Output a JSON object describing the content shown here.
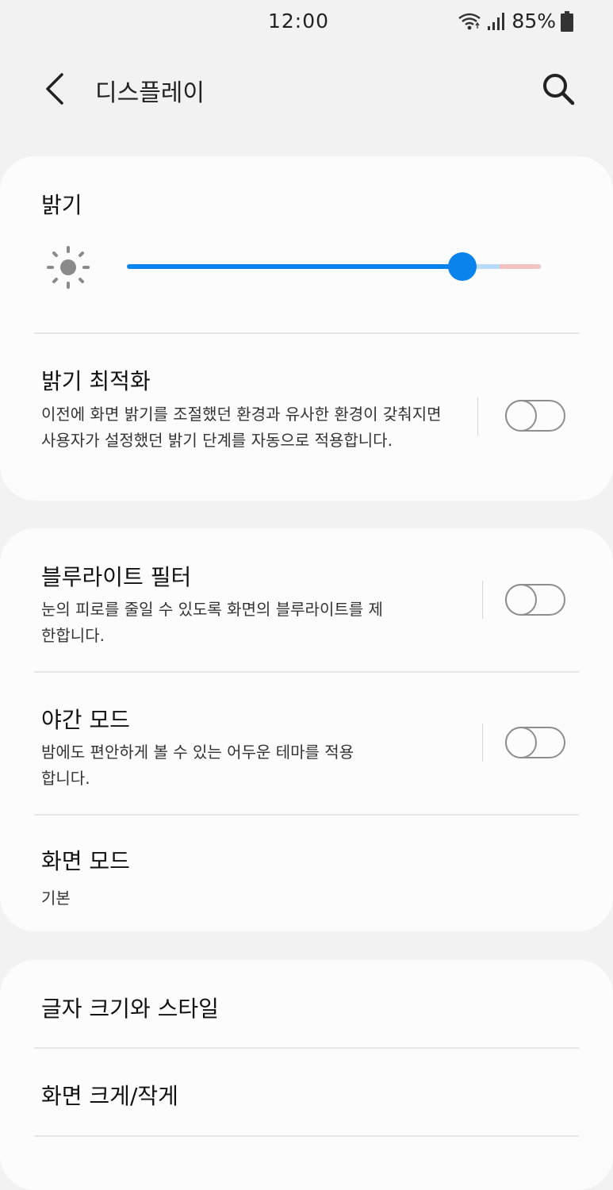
{
  "status_bar": {
    "time": "12:00",
    "battery": "85%",
    "icons": [
      "wifi-icon",
      "signal-icon",
      "battery-icon"
    ]
  },
  "header": {
    "title": "디스플레이",
    "back_icon": "back-arrow-icon",
    "search_icon": "search-icon"
  },
  "brightness": {
    "title": "밝기",
    "level": 0.81,
    "icon": "sun-icon"
  },
  "adaptive_brightness": {
    "title": "밝기 최적화",
    "description": "이전에 화면 밝기를 조절했던 환경과 유사한 환경이 갖춰지면 사용자가 설정했던 밝기 단계를 자동으로 적용합니다.",
    "enabled": false
  },
  "blue_light": {
    "title": "블루라이트 필터",
    "description": "눈의 피로를 줄일 수 있도록 화면의 블루라이트를 제한합니다.",
    "enabled": false
  },
  "dark_mode": {
    "title": "야간 모드",
    "description": "밤에도 편안하게 볼 수 있는 어두운 테마를 적용합니다.",
    "enabled": false
  },
  "screen_mode": {
    "title": "화면 모드",
    "value": "기본"
  },
  "font_style": {
    "title": "글자 크기와 스타일"
  },
  "screen_zoom": {
    "title": "화면 크게/작게"
  },
  "colors": {
    "accent": "#0a84ec",
    "background": "#f2f2f2",
    "card": "#fcfcfc"
  }
}
